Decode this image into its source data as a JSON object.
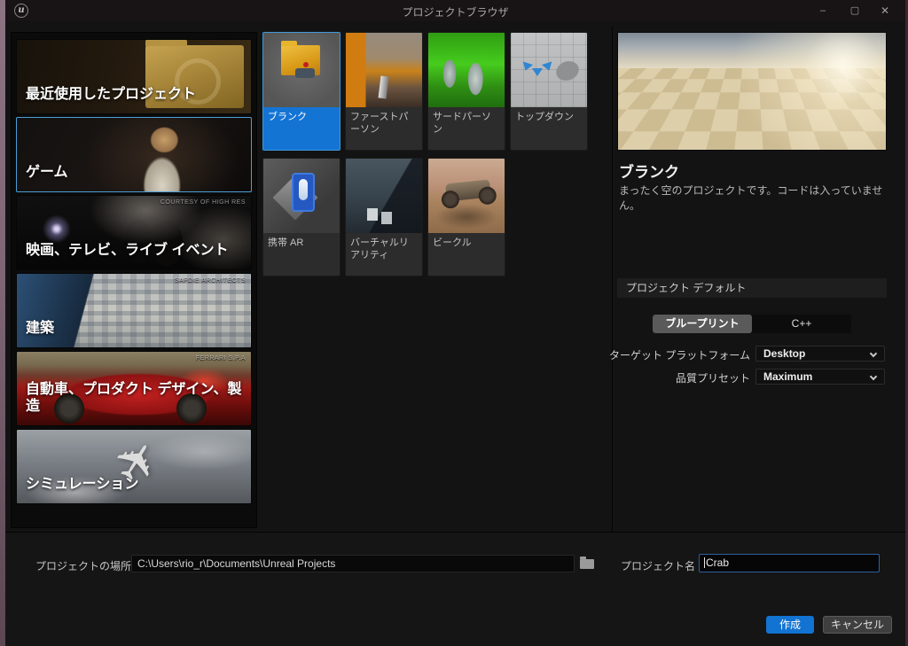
{
  "window": {
    "title": "プロジェクトブラウザ",
    "logo_glyph": "u",
    "minimize_glyph": "–",
    "maximize_glyph": "▢",
    "close_glyph": "✕"
  },
  "categories": {
    "items": [
      {
        "label": "最近使用したプロジェクト",
        "selected": false
      },
      {
        "label": "ゲーム",
        "selected": true
      },
      {
        "label": "映画、テレビ、ライブ イベント",
        "credit": "COURTESY OF HIGH RES",
        "selected": false
      },
      {
        "label": "建築",
        "credit": "SAFDIE ARCHITECTS",
        "selected": false
      },
      {
        "label": "自動車、プロダクト デザイン、製造",
        "credit": "FERRARI S.P.A",
        "selected": false
      },
      {
        "label": "シミュレーション",
        "selected": false
      }
    ]
  },
  "templates": {
    "items": [
      {
        "label": "ブランク",
        "selected": true
      },
      {
        "label": "ファーストパーソン",
        "selected": false
      },
      {
        "label": "サードパーソン",
        "selected": false
      },
      {
        "label": "トップダウン",
        "selected": false
      },
      {
        "label": "携帯 AR",
        "selected": false
      },
      {
        "label": "バーチャルリアリティ",
        "selected": false
      },
      {
        "label": "ビークル",
        "selected": false
      }
    ]
  },
  "detail": {
    "title": "ブランク",
    "description": "まったく空のプロジェクトです。コードは入っていません。",
    "defaults_header": "プロジェクト デフォルト",
    "toggle": {
      "blueprint": "ブループリント",
      "cpp": "C++",
      "selected": "ブループリント"
    },
    "settings": [
      {
        "label": "ターゲット プラットフォーム",
        "value": "Desktop"
      },
      {
        "label": "品質プリセット",
        "value": "Maximum"
      }
    ]
  },
  "footer": {
    "location_label": "プロジェクトの場所",
    "location_value": "C:\\Users\\rio_r\\Documents\\Unreal Projects",
    "name_label": "プロジェクト名",
    "name_value": "Crab",
    "create_label": "作成",
    "cancel_label": "キャンセル"
  },
  "colors": {
    "accent_blue": "#1273d2",
    "selection_blue": "#1474d4",
    "selected_border": "#4c9fd8",
    "window_bg": "#131313"
  }
}
